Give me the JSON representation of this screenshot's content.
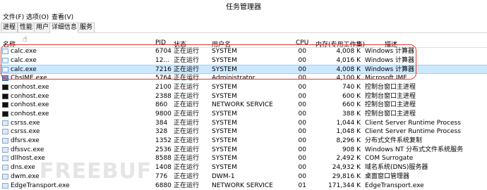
{
  "window": {
    "title": "任务管理器"
  },
  "menu": [
    "文件(F)",
    "选项(O)",
    "查看(V)"
  ],
  "tabs": [
    "进程",
    "性能",
    "用户",
    "详细信息",
    "服务"
  ],
  "active_tab": "详细信息",
  "columns": [
    "名称",
    "PID",
    "状态",
    "用户名",
    "CPU",
    "内存(专用工作集)",
    "描述"
  ],
  "rows": [
    {
      "icon": "calc",
      "name": "calc.exe",
      "pid": "6704",
      "status": "正在运行",
      "user": "SYSTEM",
      "cpu": "00",
      "mem": "4,008 K",
      "desc": "Windows 计算器"
    },
    {
      "icon": "calc",
      "name": "calc.exe",
      "pid": "12...",
      "status": "正在运行",
      "user": "SYSTEM",
      "cpu": "00",
      "mem": "4,016 K",
      "desc": "Windows 计算器"
    },
    {
      "icon": "calc",
      "name": "calc.exe",
      "pid": "7216",
      "status": "正在运行",
      "user": "SYSTEM",
      "cpu": "00",
      "mem": "4,008 K",
      "desc": "Windows 计算器",
      "selected": true
    },
    {
      "icon": "ime",
      "name": "ChsIME.exe",
      "pid": "5764",
      "status": "正在运行",
      "user": "Administrator",
      "cpu": "00",
      "mem": "4,100 K",
      "desc": "Microsoft IME"
    },
    {
      "icon": "console",
      "name": "conhost.exe",
      "pid": "2100",
      "status": "正在运行",
      "user": "SYSTEM",
      "cpu": "00",
      "mem": "740 K",
      "desc": "控制台窗口主进程"
    },
    {
      "icon": "console",
      "name": "conhost.exe",
      "pid": "2388",
      "status": "正在运行",
      "user": "SYSTEM",
      "cpu": "00",
      "mem": "600 K",
      "desc": "控制台窗口主进程"
    },
    {
      "icon": "console",
      "name": "conhost.exe",
      "pid": "860",
      "status": "正在运行",
      "user": "NETWORK SERVICE",
      "cpu": "00",
      "mem": "660 K",
      "desc": "控制台窗口主进程"
    },
    {
      "icon": "console",
      "name": "conhost.exe",
      "pid": "9800",
      "status": "正在运行",
      "user": "SYSTEM",
      "cpu": "00",
      "mem": "388 K",
      "desc": "控制台窗口主进程"
    },
    {
      "icon": "sys",
      "name": "csrss.exe",
      "pid": "384",
      "status": "正在运行",
      "user": "SYSTEM",
      "cpu": "00",
      "mem": "1,044 K",
      "desc": "Client Server Runtime Process"
    },
    {
      "icon": "sys",
      "name": "csrss.exe",
      "pid": "328",
      "status": "正在运行",
      "user": "SYSTEM",
      "cpu": "00",
      "mem": "1,048 K",
      "desc": "Client Server Runtime Process"
    },
    {
      "icon": "sys",
      "name": "dfsrs.exe",
      "pid": "1352",
      "status": "正在运行",
      "user": "SYSTEM",
      "cpu": "00",
      "mem": "8,296 K",
      "desc": "分布式文件系统复制"
    },
    {
      "icon": "sys",
      "name": "dfssvc.exe",
      "pid": "2536",
      "status": "正在运行",
      "user": "SYSTEM",
      "cpu": "00",
      "mem": "908 K",
      "desc": "Windows NT 分布式文件系统服务"
    },
    {
      "icon": "sys",
      "name": "dllhost.exe",
      "pid": "8588",
      "status": "正在运行",
      "user": "SYSTEM",
      "cpu": "00",
      "mem": "2,492 K",
      "desc": "COM Surrogate"
    },
    {
      "icon": "sys",
      "name": "dns.exe",
      "pid": "1408",
      "status": "正在运行",
      "user": "SYSTEM",
      "cpu": "00",
      "mem": "24,932 K",
      "desc": "域名系统(DNS)服务器"
    },
    {
      "icon": "sys",
      "name": "dwm.exe",
      "pid": "776",
      "status": "正在运行",
      "user": "DWM-1",
      "cpu": "00",
      "mem": "29,816 K",
      "desc": "桌面窗口管理器"
    },
    {
      "icon": "sys",
      "name": "EdgeTransport.exe",
      "pid": "6880",
      "status": "正在运行",
      "user": "NETWORK SERVICE",
      "cpu": "01",
      "mem": "171,344 K",
      "desc": "EdgeTransport.exe"
    }
  ],
  "watermark": "FREEBUF"
}
